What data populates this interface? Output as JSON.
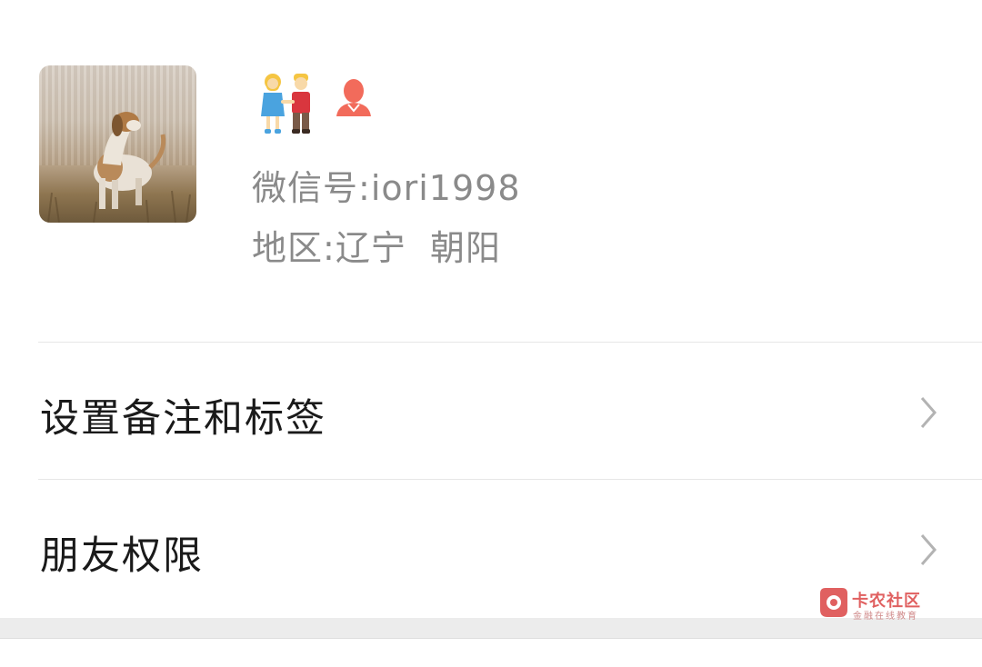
{
  "profile": {
    "avatar_name": "dog-avatar",
    "status_icons": [
      "couple-emoji-icon",
      "person-silhouette-icon"
    ],
    "wechat_id_label": "微信号:",
    "wechat_id_value": "iori1998",
    "region_label": "地区:",
    "region_value": "辽宁  朝阳"
  },
  "menu": {
    "items": [
      {
        "label": "设置备注和标签",
        "icon": "chevron-right-icon"
      },
      {
        "label": "朋友权限",
        "icon": "chevron-right-icon"
      }
    ]
  },
  "watermark": {
    "title": "卡农社区",
    "subtitle": "金融在线教育"
  },
  "colors": {
    "text_primary": "#1a1a1a",
    "text_secondary": "#8a8a8a",
    "chevron": "#b3b3b3",
    "divider": "#e6e6e6",
    "person_icon": "#f26b5b",
    "watermark": "#e06060"
  }
}
